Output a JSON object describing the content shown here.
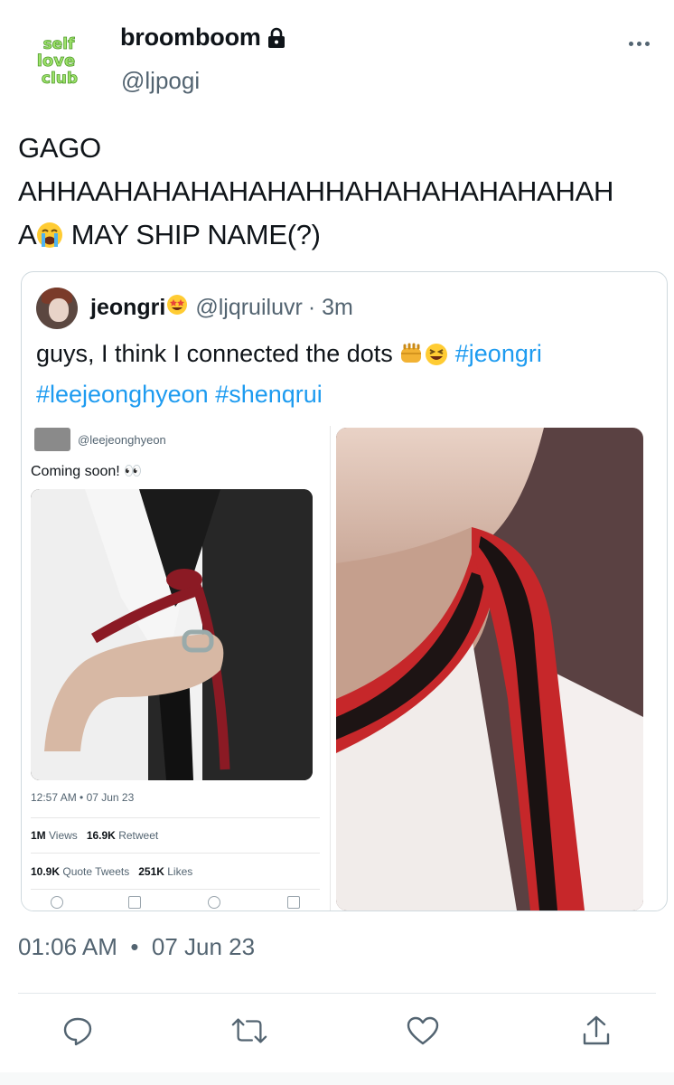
{
  "author": {
    "display_name": "broomboom",
    "handle": "@ljpogi",
    "avatar_text": [
      "self",
      "love",
      "club"
    ]
  },
  "tweet": {
    "lines": [
      "GAGO",
      "AHHAAHAHAHAHAHAHHAHAHAHAHAHAHAH",
      "A",
      " MAY SHIP NAME(?)"
    ]
  },
  "quote": {
    "display_name": "jeongri",
    "handle": "@ljqruiluvr",
    "time": "· 3m",
    "text": "guys, I think I connected the dots ",
    "hashtags": [
      "#jeongri",
      "#leejeonghyeon",
      "#shenqrui"
    ],
    "embedded_tweet": {
      "handle": "@leejeonghyeon",
      "text": "Coming soon! 👀",
      "meta": "12:57 AM  •  07 Jun 23",
      "views": "1M",
      "views_label": "Views",
      "retweets": "16.9K",
      "retweets_label": "Retweet",
      "quotes": "10.9K",
      "quotes_label": "Quote Tweets",
      "likes": "251K",
      "likes_label": "Likes"
    }
  },
  "footer": {
    "time": "01:06 AM",
    "dot": "•",
    "date": "07 Jun 23"
  },
  "icons": {
    "lock": "lock-icon",
    "more": "more-options-icon",
    "reply": "reply-icon",
    "retweet": "retweet-icon",
    "like": "heart-icon",
    "share": "share-icon"
  },
  "colors": {
    "text": "#0f1419",
    "secondary": "#536471",
    "link": "#1d9bf0",
    "border": "#cfd9de"
  }
}
